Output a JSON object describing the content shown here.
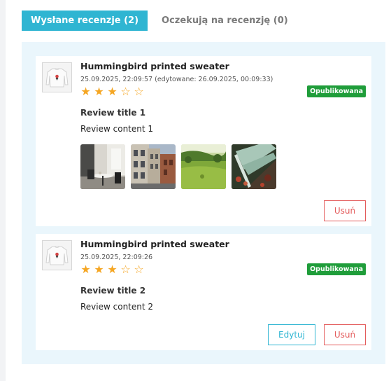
{
  "tabs": [
    {
      "label": "Wysłane recenzje (2)",
      "active": true
    },
    {
      "label": "Oczekują na recenzję (0)",
      "active": false
    }
  ],
  "colors": {
    "accent": "#2fb5d2",
    "badge": "#1f9d3a",
    "star": "#f5a623",
    "delete": "#e35a5a",
    "panel": "#eaf6fc"
  },
  "reviews": [
    {
      "product": "Hummingbird printed sweater",
      "date": "25.09.2025, 22:09:57 (edytowane: 26.09.2025, 00:09:33)",
      "rating": 3,
      "rating_max": 5,
      "status": "Opublikowana",
      "title": "Review title 1",
      "content": "Review content 1",
      "photos": [
        "cafe-table-photo",
        "street-buildings-photo",
        "green-field-photo",
        "stairs-garden-photo"
      ],
      "delete_label": "Usuń"
    },
    {
      "product": "Hummingbird printed sweater",
      "date": "25.09.2025, 22:09:26",
      "rating": 3,
      "rating_max": 5,
      "status": "Opublikowana",
      "title": "Review title 2",
      "content": "Review content 2",
      "edit_label": "Edytuj",
      "delete_label": "Usuń"
    }
  ]
}
